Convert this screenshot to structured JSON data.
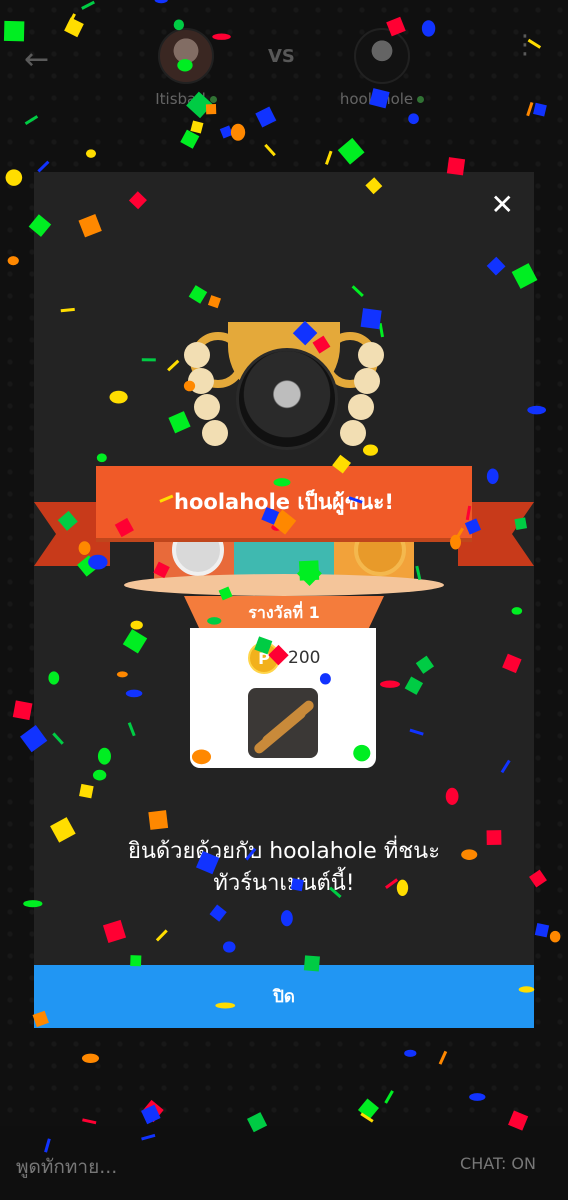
{
  "header": {
    "back_icon": "back-arrow-icon",
    "vs_label": "VS",
    "player1": {
      "name": "Itisbad"
    },
    "player2": {
      "name": "hoolahole"
    },
    "menu_icon": "more-vert-icon"
  },
  "modal": {
    "close_icon": "close-icon",
    "winner_banner": "hoolahole เป็นผู้ชนะ!",
    "rank_label": "รางวัลที่ 1",
    "coin_icon_letter": "P",
    "coin_amount": "200",
    "item_icon": "rolling-pin-icon",
    "congrats_line1": "ยินด้วยด้วยกับ hoolahole ที่ชนะ",
    "congrats_line2": "ทัวร์นาเมนต์นี้!",
    "close_button": "ปิด"
  },
  "chat": {
    "placeholder": "พูดทักทาย...",
    "status": "CHAT: ON"
  },
  "colors": {
    "accent_blue": "#2196f3",
    "ribbon_orange": "#f05a28",
    "coin_gold": "#f2b11c"
  }
}
